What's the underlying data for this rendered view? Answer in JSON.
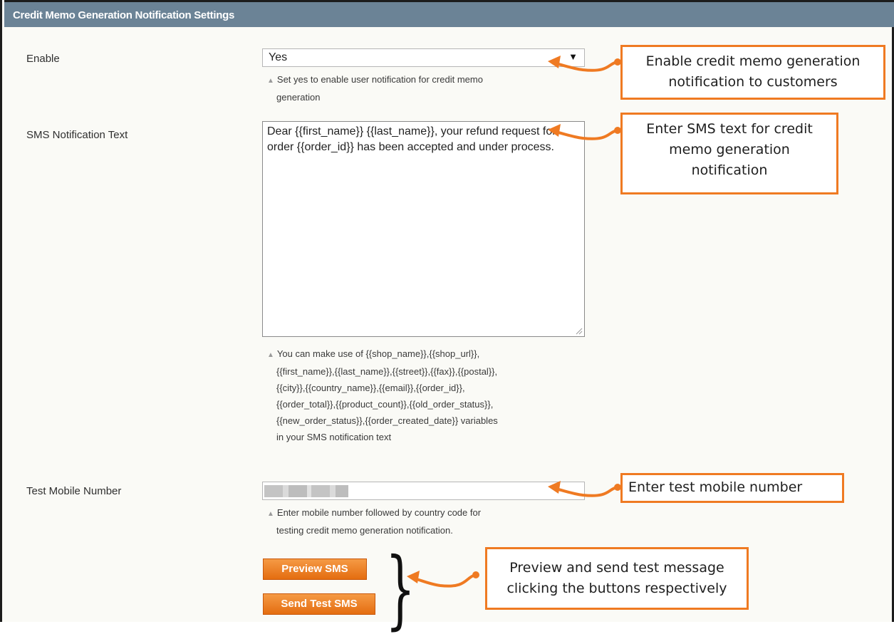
{
  "panel": {
    "title": "Credit Memo Generation Notification Settings"
  },
  "fields": {
    "enable": {
      "label": "Enable",
      "value": "Yes",
      "note_line1": "Set yes to enable user notification for credit memo",
      "note_line2": "generation"
    },
    "sms_text": {
      "label": "SMS Notification Text",
      "value": "Dear {{first_name}} {{last_name}}, your refund request for order {{order_id}} has been accepted and under process.",
      "note_lines": [
        "You can make use of {{shop_name}},{{shop_url}},",
        "{{first_name}},{{last_name}},{{street}},{{fax}},{{postal}},",
        "{{city}},{{country_name}},{{email}},{{order_id}},",
        "{{order_total}},{{product_count}},{{old_order_status}},",
        "{{new_order_status}},{{order_created_date}} variables",
        "in your SMS notification text"
      ]
    },
    "test_mobile": {
      "label": "Test Mobile Number",
      "note_line1": "Enter mobile number followed by country code for",
      "note_line2": "testing credit memo generation notification."
    }
  },
  "buttons": {
    "preview": "Preview SMS",
    "send_test": "Send Test SMS"
  },
  "callouts": {
    "enable": [
      "Enable credit memo generation",
      "notification to customers"
    ],
    "sms_text": [
      "Enter SMS text for credit",
      "memo generation",
      "notification"
    ],
    "mobile": [
      "Enter test mobile number"
    ],
    "buttons": [
      "Preview and send test message",
      "clicking the buttons respectively"
    ]
  },
  "colors": {
    "header": "#6b8396",
    "accent": "#ef7a22",
    "button": "#e46d10"
  },
  "icons": [
    "dropdown-arrow-icon",
    "note-triangle-icon",
    "resize-grip-icon",
    "curved-arrow-icon",
    "brace-icon"
  ]
}
